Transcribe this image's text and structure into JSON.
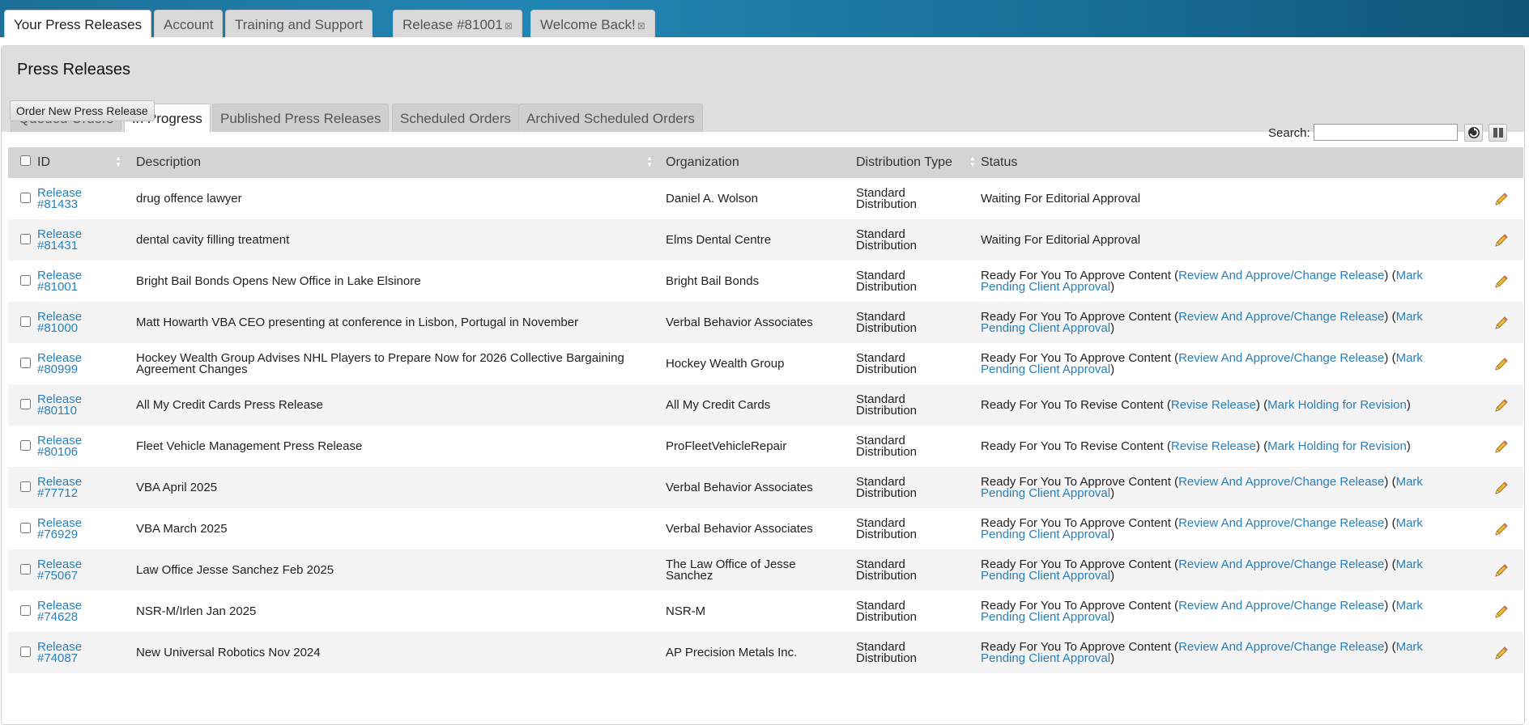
{
  "top_tabs": [
    {
      "label": "Your Press Releases",
      "active": true,
      "closable": false
    },
    {
      "label": "Account",
      "active": false,
      "closable": false
    },
    {
      "label": "Training and Support",
      "active": false,
      "closable": false
    },
    {
      "label": "Release #81001",
      "active": false,
      "closable": true
    },
    {
      "label": "Welcome Back!",
      "active": false,
      "closable": true
    }
  ],
  "close_glyph": "⊠",
  "panel": {
    "title": "Press Releases",
    "tabs": [
      {
        "label": "Queued Orders",
        "active": false
      },
      {
        "label": "In Progress",
        "active": true
      },
      {
        "label": "Published Press Releases",
        "active": false
      },
      {
        "label": "Scheduled Orders",
        "active": false
      },
      {
        "label": "Archived Scheduled Orders",
        "active": false
      }
    ],
    "order_button": "Order New Press Release",
    "search_label": "Search:",
    "search_value": ""
  },
  "table": {
    "columns": [
      "ID",
      "Description",
      "Organization",
      "Distribution Type",
      "Status"
    ],
    "rows": [
      {
        "id_l1": "Release",
        "id_l2": "#81433",
        "desc": "drug offence lawyer",
        "org": "Daniel A. Wolson",
        "dist_l1": "Standard",
        "dist_l2": "Distribution",
        "status_type": "editorial",
        "status": "Waiting For Editorial Approval"
      },
      {
        "id_l1": "Release",
        "id_l2": "#81431",
        "desc": "dental cavity filling treatment",
        "org": "Elms Dental Centre",
        "dist_l1": "Standard",
        "dist_l2": "Distribution",
        "status_type": "editorial",
        "status": "Waiting For Editorial Approval"
      },
      {
        "id_l1": "Release",
        "id_l2": "#81001",
        "desc": "Bright Bail Bonds Opens New Office in Lake Elsinore",
        "org": "Bright Bail Bonds",
        "dist_l1": "Standard",
        "dist_l2": "Distribution",
        "status_type": "approve",
        "status": "Ready For You To Approve Content"
      },
      {
        "id_l1": "Release",
        "id_l2": "#81000",
        "desc": "Matt Howarth VBA CEO presenting at conference in Lisbon, Portugal in November",
        "org": "Verbal Behavior Associates",
        "dist_l1": "Standard",
        "dist_l2": "Distribution",
        "status_type": "approve",
        "status": "Ready For You To Approve Content"
      },
      {
        "id_l1": "Release",
        "id_l2": "#80999",
        "desc": "Hockey Wealth Group Advises NHL Players to Prepare Now for 2026 Collective Bargaining Agreement Changes",
        "org": "Hockey Wealth Group",
        "dist_l1": "Standard",
        "dist_l2": "Distribution",
        "status_type": "approve",
        "status": "Ready For You To Approve Content"
      },
      {
        "id_l1": "Release",
        "id_l2": "#80110",
        "desc": "All My Credit Cards Press Release",
        "org": "All My Credit Cards",
        "dist_l1": "Standard",
        "dist_l2": "Distribution",
        "status_type": "revise",
        "status": "Ready For You To Revise Content"
      },
      {
        "id_l1": "Release",
        "id_l2": "#80106",
        "desc": "Fleet Vehicle Management Press Release",
        "org": "ProFleetVehicleRepair",
        "dist_l1": "Standard",
        "dist_l2": "Distribution",
        "status_type": "revise",
        "status": "Ready For You To Revise Content"
      },
      {
        "id_l1": "Release",
        "id_l2": "#77712",
        "desc": "VBA April 2025",
        "org": "Verbal Behavior Associates",
        "dist_l1": "Standard",
        "dist_l2": "Distribution",
        "status_type": "approve",
        "status": "Ready For You To Approve Content"
      },
      {
        "id_l1": "Release",
        "id_l2": "#76929",
        "desc": "VBA March 2025",
        "org": "Verbal Behavior Associates",
        "dist_l1": "Standard",
        "dist_l2": "Distribution",
        "status_type": "approve",
        "status": "Ready For You To Approve Content"
      },
      {
        "id_l1": "Release",
        "id_l2": "#75067",
        "desc": "Law Office Jesse Sanchez Feb 2025",
        "org": "The Law Office of Jesse Sanchez",
        "dist_l1": "Standard",
        "dist_l2": "Distribution",
        "status_type": "approve",
        "status": "Ready For You To Approve Content"
      },
      {
        "id_l1": "Release",
        "id_l2": "#74628",
        "desc": "NSR-M/Irlen Jan 2025",
        "org": "NSR-M",
        "dist_l1": "Standard",
        "dist_l2": "Distribution",
        "status_type": "approve",
        "status": "Ready For You To Approve Content"
      },
      {
        "id_l1": "Release",
        "id_l2": "#74087",
        "desc": "New Universal Robotics Nov 2024",
        "org": "AP Precision Metals Inc.",
        "dist_l1": "Standard",
        "dist_l2": "Distribution",
        "status_type": "approve",
        "status": "Ready For You To Approve Content"
      }
    ]
  },
  "status_links": {
    "review": "Review And Approve/Change Release",
    "mark_pending": "Mark Pending Client Approval",
    "revise": "Revise Release",
    "mark_holding": "Mark Holding for Revision"
  },
  "icons": {
    "edit": "pencil-icon",
    "refresh": "refresh-icon",
    "columns": "columns-icon",
    "sort": "sort-arrows-icon"
  },
  "colors": {
    "link": "#2a7fb8",
    "header_bg": "#1c6f97",
    "pencil": "#e8b23a"
  }
}
